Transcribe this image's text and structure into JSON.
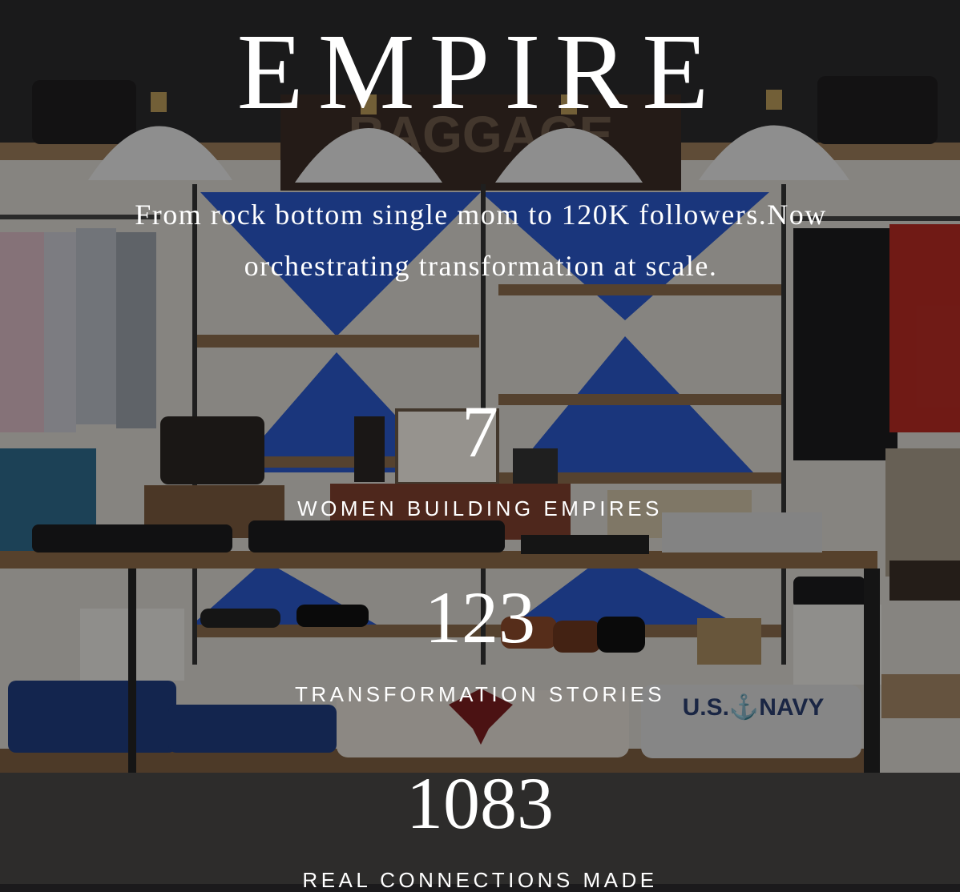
{
  "hero": {
    "title": "EMPIRE",
    "tagline_line1": "From rock bottom single mom to 120K followers.Now",
    "tagline_line2": "orchestrating transformation at scale."
  },
  "stats": [
    {
      "number": "7",
      "label": "WOMEN BUILDING EMPIRES"
    },
    {
      "number": "123",
      "label": "TRANSFORMATION STORIES"
    },
    {
      "number": "1083",
      "label": "REAL CONNECTIONS MADE"
    }
  ],
  "background_image": {
    "subject": "clothing boutique interior with pendant lamps, shelves, shoes and folded garments",
    "sign_text": "BAGGAGE",
    "sweater_text": "U.S.⚓NAVY"
  }
}
